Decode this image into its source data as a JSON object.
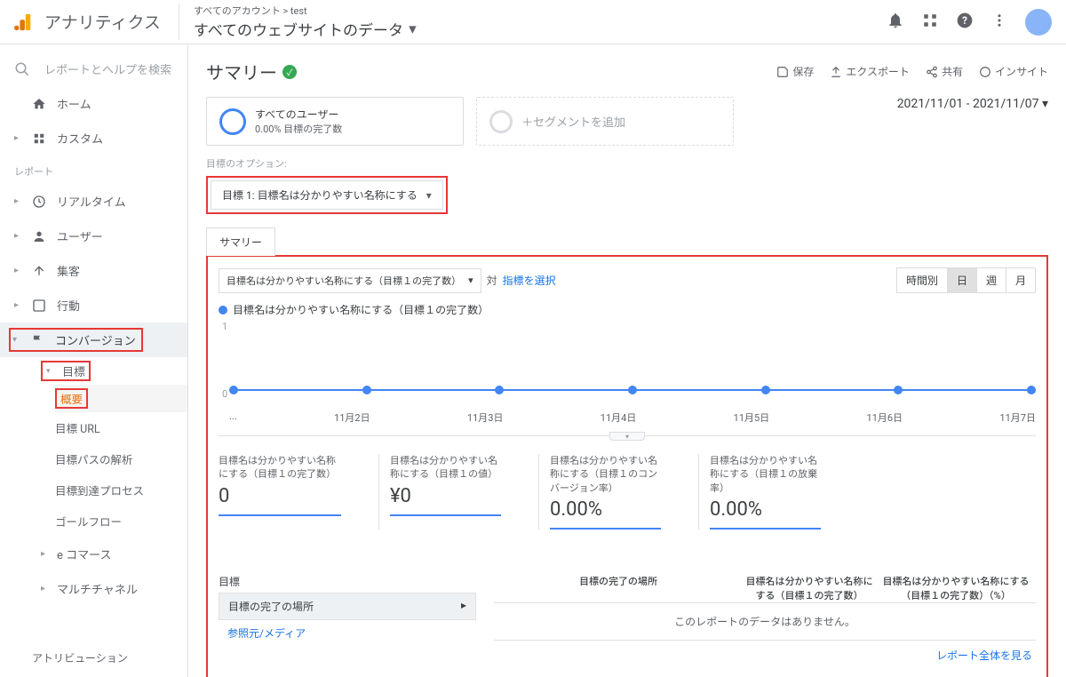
{
  "brand": "アナリティクス",
  "breadcrumb": "すべてのアカウント > test",
  "header_title": "すべてのウェブサイトのデータ",
  "search_placeholder": "レポートとヘルプを検索",
  "sidebar": {
    "home": "ホーム",
    "custom": "カスタム",
    "reports_label": "レポート",
    "realtime": "リアルタイム",
    "user": "ユーザー",
    "acquisition": "集客",
    "behavior": "行動",
    "conversion": "コンバージョン",
    "goals": "目標",
    "overview": "概要",
    "goal_url": "目標 URL",
    "goal_path": "目標パスの解析",
    "goal_funnel": "目標到達プロセス",
    "goal_flow": "ゴールフロー",
    "ecommerce": "e コマース",
    "multichannel": "マルチチャネル",
    "attribution": "アトリビューション"
  },
  "page": {
    "title": "サマリー",
    "actions": {
      "save": "保存",
      "export": "エクスポート",
      "share": "共有",
      "insight": "インサイト"
    },
    "date_range": "2021/11/01 - 2021/11/07",
    "segment_all_users": "すべてのユーザー",
    "segment_sub": "0.00% 目標の完了数",
    "segment_add": "＋セグメントを追加",
    "goal_option_label": "目標のオプション:",
    "goal_option_value": "目標 1: 目標名は分かりやすい名称にする",
    "tab_summary": "サマリー",
    "metric_selector": "目標名は分かりやすい名称にする（目標１の完了数）",
    "vs": "対",
    "select_metric": "指標を選択",
    "time_hour": "時間別",
    "time_day": "日",
    "time_week": "週",
    "time_month": "月",
    "legend": "目標名は分かりやすい名称にする（目標１の完了数）",
    "metrics": [
      {
        "label": "目標名は分かりやすい名称にする（目標１の完了数）",
        "value": "0"
      },
      {
        "label": "目標名は分かりやすい名称にする（目標１の値）",
        "value": "¥0"
      },
      {
        "label": "目標名は分かりやすい名称にする（目標１のコンバージョン率）",
        "value": "0.00%"
      },
      {
        "label": "目標名は分かりやすい名称にする（目標１の放棄率）",
        "value": "0.00%"
      }
    ],
    "table": {
      "heading": "目標",
      "left_options": [
        "目標の完了の場所",
        "参照元/メディア"
      ],
      "col_place": "目標の完了の場所",
      "col_completions": "目標名は分かりやすい名称にする（目標１の完了数）",
      "col_percent": "目標名は分かりやすい名称にする（目標１の完了数）（%）",
      "no_data": "このレポートのデータはありません。",
      "full_report": "レポート全体を見る"
    }
  },
  "chart_data": {
    "type": "line",
    "categories": [
      "...",
      "11月2日",
      "11月3日",
      "11月4日",
      "11月5日",
      "11月6日",
      "11月7日"
    ],
    "values": [
      0,
      0,
      0,
      0,
      0,
      0,
      0
    ],
    "ylim": [
      0,
      1
    ],
    "series_name": "目標名は分かりやすい名称にする（目標１の完了数）"
  }
}
